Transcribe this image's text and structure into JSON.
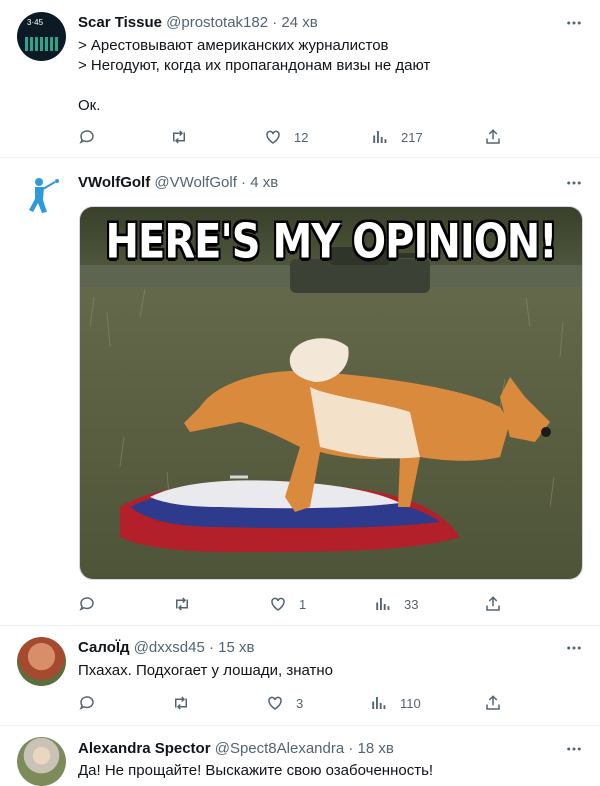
{
  "tweets": [
    {
      "name": "Scar Tissue",
      "handle": "@prostotak182",
      "time": "24 хв",
      "avatar_text": "3·45",
      "text": "> Арестовывают американских журналистов\n> Негодуют, когда их пропагандонам визы не дают\n\nОк.",
      "reply_count": "",
      "retweet_count": "",
      "like_count": "12",
      "views_count": "217"
    },
    {
      "name": "VWolfGolf",
      "handle": "@VWolfGolf",
      "time": "4 хв",
      "media_caption": "HERE'S MY OPINION!",
      "reply_count": "",
      "retweet_count": "",
      "like_count": "1",
      "views_count": "33"
    },
    {
      "name": "СалоЇд",
      "handle": "@dxxsd45",
      "time": "15 хв",
      "text": "Пхахах. Подхогает у лошади, знатно",
      "reply_count": "",
      "retweet_count": "",
      "like_count": "3",
      "views_count": "110"
    },
    {
      "name": "Alexandra Spector",
      "handle": "@Spect8Alexandra",
      "time": "18 хв",
      "text": "Да! Не прощайте! Выскажите свою озабоченность!"
    }
  ],
  "dot": "·",
  "colors": {
    "secondary": "#536471",
    "border": "#eff3f4"
  }
}
